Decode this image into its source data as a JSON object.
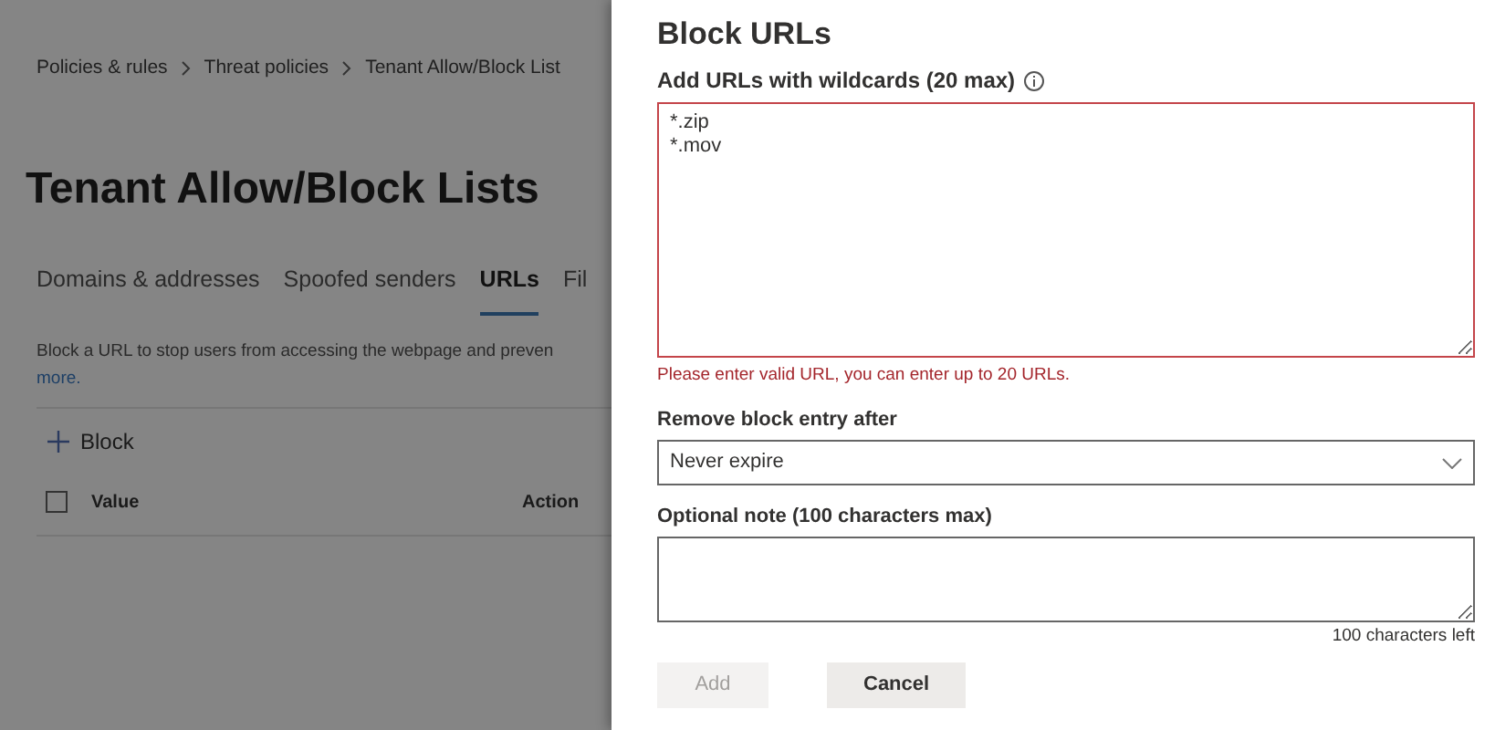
{
  "page": {
    "breadcrumb": [
      {
        "label": "Policies & rules"
      },
      {
        "label": "Threat policies"
      },
      {
        "label": "Tenant Allow/Block List"
      }
    ],
    "title": "Tenant Allow/Block Lists",
    "tabs": [
      {
        "label": "Domains & addresses",
        "selected": false
      },
      {
        "label": "Spoofed senders",
        "selected": false
      },
      {
        "label": "URLs",
        "selected": true
      },
      {
        "label": "Fil",
        "selected": false
      }
    ],
    "description": "Block a URL to stop users from accessing the webpage and preven",
    "learn_more": "more.",
    "toolbar": {
      "block_button": "Block"
    },
    "table": {
      "select_all_checked": false,
      "columns": [
        "Value",
        "Action"
      ]
    }
  },
  "panel": {
    "title": "Block URLs",
    "urls": {
      "label": "Add URLs with wildcards (20 max)",
      "value": "*.zip\n*.mov",
      "invalid": true,
      "error": "Please enter valid URL, you can enter up to 20 URLs."
    },
    "expiry": {
      "label": "Remove block entry after",
      "value": "Never expire"
    },
    "note": {
      "label": "Optional note (100 characters max)",
      "counter": "100 characters left"
    },
    "buttons": [
      {
        "label": "Add",
        "disabled": true
      },
      {
        "label": "Cancel",
        "disabled": false
      }
    ]
  }
}
